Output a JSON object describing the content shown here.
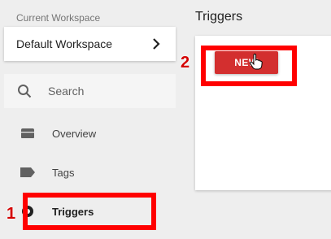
{
  "sidebar": {
    "workspace_label": "Current Workspace",
    "workspace_name": "Default Workspace",
    "search_placeholder": "Search",
    "items": [
      {
        "label": "Overview",
        "icon": "folder-icon"
      },
      {
        "label": "Tags",
        "icon": "tag-icon"
      },
      {
        "label": "Triggers",
        "icon": "trigger-icon",
        "active": true
      }
    ]
  },
  "main": {
    "title": "Triggers",
    "new_button_label": "NEW"
  },
  "annotations": {
    "step1": "1",
    "step2": "2",
    "highlight_color": "#ff0000"
  },
  "colors": {
    "new_button": "#d32f2f",
    "background": "#eeeeee"
  }
}
